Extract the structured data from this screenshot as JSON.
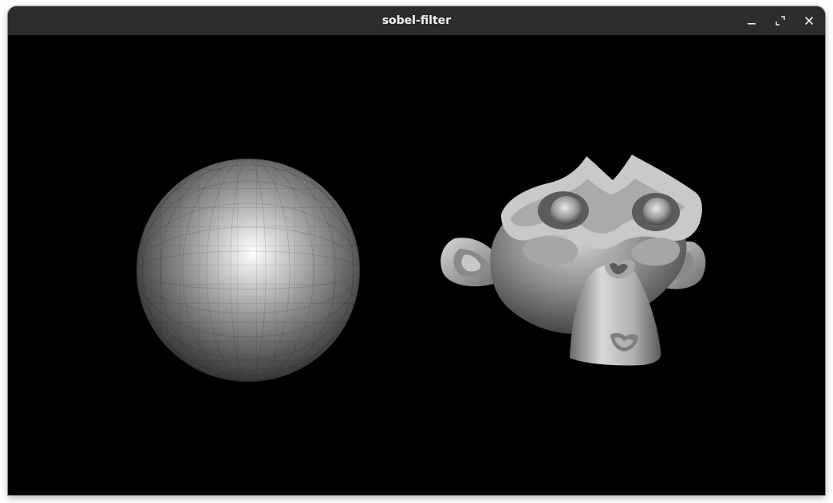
{
  "window": {
    "title": "sobel-filter"
  },
  "controls": {
    "minimize_icon": "minimize-icon",
    "maximize_icon": "maximize-icon",
    "close_icon": "close-icon"
  },
  "scene": {
    "background": "#000000",
    "objects": [
      "uv-sphere",
      "suzanne-monkey-head"
    ],
    "shading": "grayscale"
  }
}
